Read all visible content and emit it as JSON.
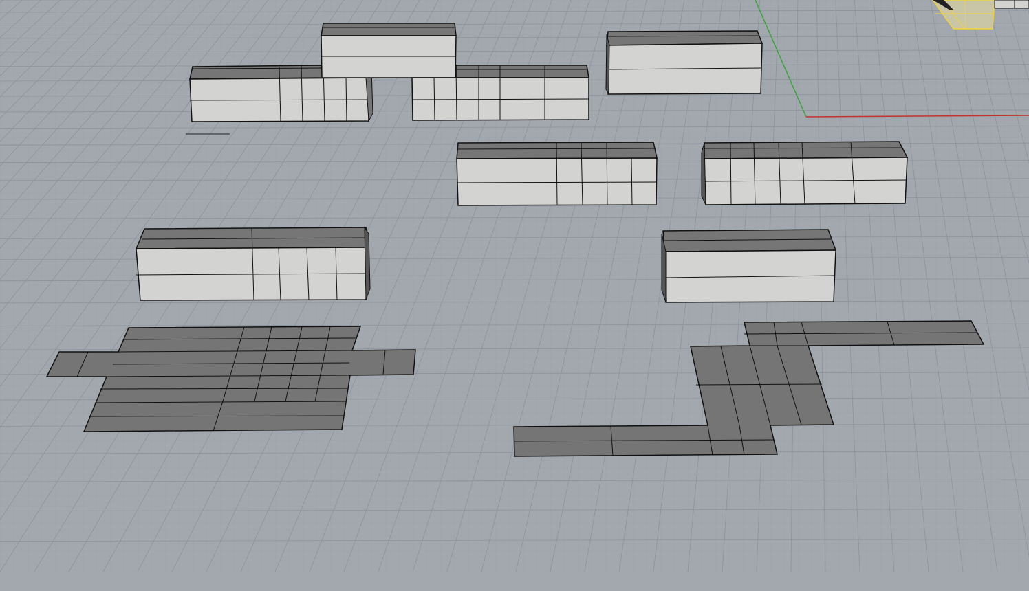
{
  "viewport": {
    "mode": "perspective",
    "background": "#a3a8af",
    "grid_minor_color": "#98a0a8",
    "grid_major_color": "#8a929b",
    "x_axis_color": "#c0332e",
    "y_axis_color": "#3aa33a",
    "selection_color": "#f2d23a"
  },
  "objects": {
    "box_face_color": "#d3d3d1",
    "box_top_color": "#767676",
    "flat_surface_color": "#757575",
    "edge_color": "#111111"
  }
}
